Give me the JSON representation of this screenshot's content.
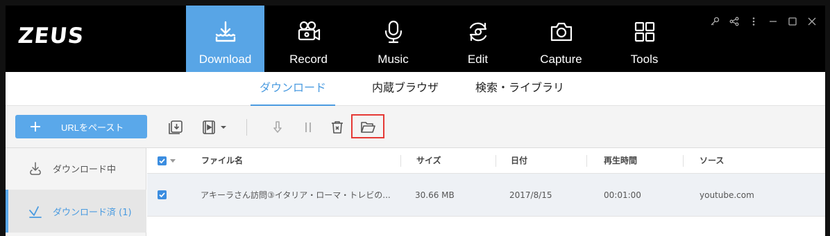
{
  "app": {
    "logo": "ZEUS"
  },
  "nav": {
    "tabs": [
      {
        "label": "Download",
        "icon": "download-icon",
        "active": true
      },
      {
        "label": "Record",
        "icon": "video-camera-icon",
        "active": false
      },
      {
        "label": "Music",
        "icon": "microphone-icon",
        "active": false
      },
      {
        "label": "Edit",
        "icon": "sync-icon",
        "active": false
      },
      {
        "label": "Capture",
        "icon": "camera-icon",
        "active": false
      },
      {
        "label": "Tools",
        "icon": "grid-icon",
        "active": false
      }
    ]
  },
  "subtabs": [
    {
      "label": "ダウンロード",
      "active": true
    },
    {
      "label": "内蔵ブラウザ",
      "active": false
    },
    {
      "label": "検索・ライブラリ",
      "active": false
    }
  ],
  "toolbar": {
    "paste_label": "URLをペースト"
  },
  "sidebar": {
    "items": [
      {
        "label": "ダウンロード中",
        "icon": "download-progress-icon"
      },
      {
        "label": "ダウンロード済 (1)",
        "icon": "download-done-icon"
      }
    ]
  },
  "table": {
    "headers": {
      "name": "ファイル名",
      "size": "サイズ",
      "date": "日付",
      "duration": "再生時間",
      "source": "ソース"
    },
    "rows": [
      {
        "name": "アキーラさん訪問③イタリア・ローマ・トレビの...",
        "size": "30.66 MB",
        "date": "2017/8/15",
        "duration": "00:01:00",
        "source": "youtube.com"
      }
    ]
  },
  "colors": {
    "accent": "#58a5e6",
    "highlight": "#e53935",
    "header_bg": "#000000"
  }
}
